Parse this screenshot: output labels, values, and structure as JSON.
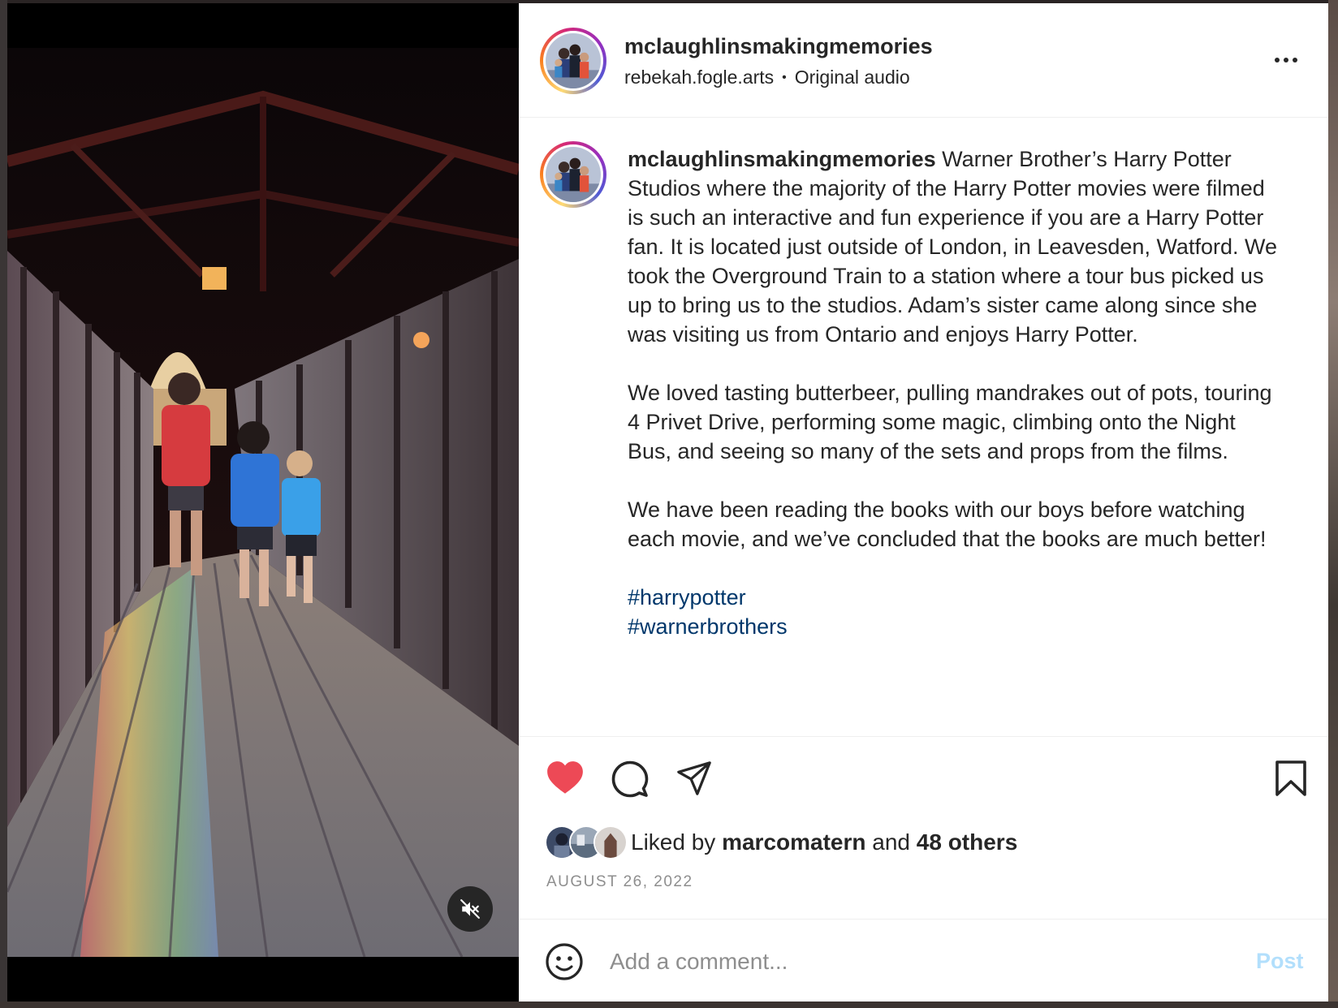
{
  "post": {
    "username": "mclaughlinsmakingmemories",
    "audio_author": "rebekah.fogle.arts",
    "separator": "•",
    "audio_label": "Original audio",
    "caption_paragraphs": [
      "Warner Brother’s Harry Potter Studios where the majority of the Harry Potter movies were filmed is such an interactive and fun experience if you are a Harry Potter fan. It is located just outside of London, in Leavesden, Watford. We took the Overground Train to a station where a tour bus picked us up to bring us to the studios. Adam’s sister came along since she was visiting us from Ontario and enjoys Harry Potter.",
      "We loved tasting butterbeer, pulling mandrakes out of pots, touring 4 Privet Drive, performing some magic, climbing onto the Night Bus, and seeing so many of the sets and props from the films.",
      "We have been reading the books with our boys before watching each movie, and we’ve concluded that the books are much better!"
    ],
    "hashtags": [
      "#harrypotter",
      "#warnerbrothers"
    ],
    "liked_by_prefix": "Liked by",
    "liked_by_user": "marcomatern",
    "liked_by_and": "and",
    "liked_by_others": "48 others",
    "date": "AUGUST 26, 2022",
    "liked": true
  },
  "icons": {
    "more": "more-horizontal-icon",
    "like": "heart-filled-icon",
    "comment": "comment-bubble-icon",
    "share": "paper-plane-icon",
    "save": "bookmark-icon",
    "mute": "speaker-muted-icon",
    "emoji": "smiley-icon"
  },
  "comment_box": {
    "placeholder": "Add a comment...",
    "post_label": "Post"
  },
  "colors": {
    "like_red": "#ed4956",
    "hashtag_blue": "#00376b",
    "post_disabled": "#b2dffc",
    "muted_gray": "#8e8e8e"
  }
}
